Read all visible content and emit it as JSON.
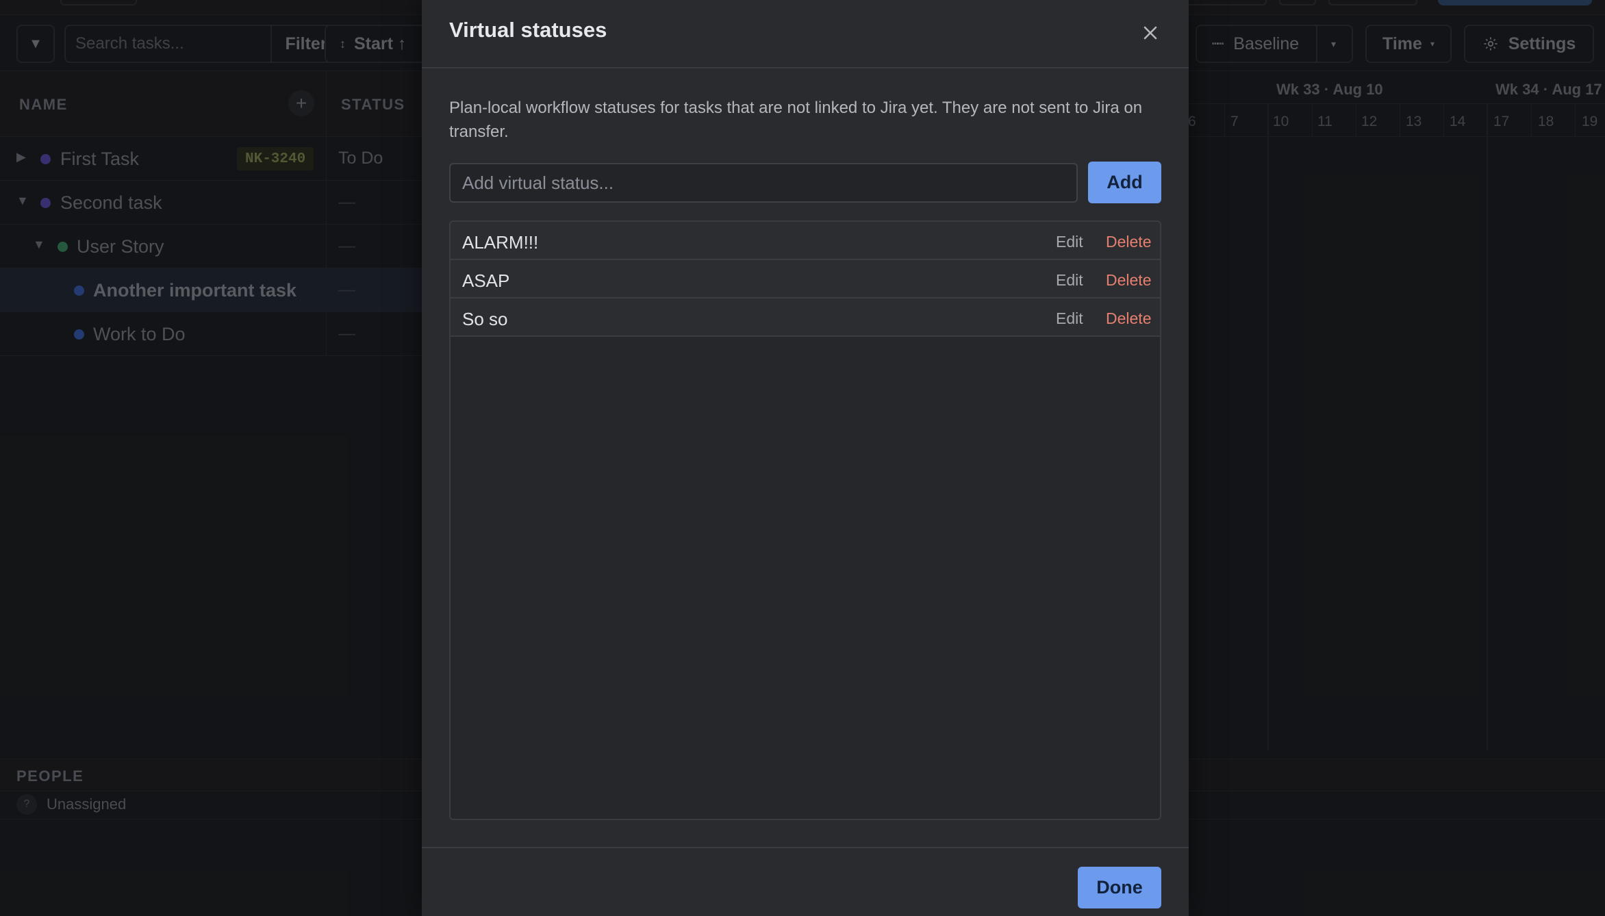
{
  "toolbar": {
    "search_placeholder": "Search tasks...",
    "filter_label": "Filter",
    "sort_label": "Start ↑",
    "baseline_label": "Baseline",
    "time_label": "Time",
    "settings_label": "Settings"
  },
  "grid": {
    "name_header": "NAME",
    "status_header": "STATUS",
    "rows": [
      {
        "name": "First Task",
        "key": "NK-3240",
        "status": "To Do",
        "dot_color": "#5b4fc4"
      },
      {
        "name": "Second task",
        "status": "—",
        "dot_color": "#5b4fc4"
      },
      {
        "name": "User Story",
        "status": "—",
        "dot_color": "#3f9a6a"
      },
      {
        "name": "Another important task",
        "status": "—",
        "dot_color": "#3a63c8"
      },
      {
        "name": "Work to Do",
        "status": "—",
        "dot_color": "#3a63c8"
      }
    ]
  },
  "timeline": {
    "weeks": [
      "Wk 33 · Aug 10",
      "Wk 34 · Aug 17"
    ],
    "days": [
      "6",
      "7",
      "10",
      "11",
      "12",
      "13",
      "14",
      "17",
      "18",
      "19"
    ]
  },
  "people": {
    "title": "PEOPLE",
    "unassigned": "Unassigned",
    "unassigned_icon": "?"
  },
  "modal": {
    "title": "Virtual statuses",
    "description": "Plan-local workflow statuses for tasks that are not linked to Jira yet. They are not sent to Jira on transfer.",
    "input_placeholder": "Add virtual status...",
    "add_label": "Add",
    "edit_label": "Edit",
    "delete_label": "Delete",
    "statuses": [
      "ALARM!!!",
      "ASAP",
      "So so"
    ],
    "done_label": "Done"
  },
  "colors": {
    "accent": "#6c9aec",
    "delete": "#e6806e",
    "jira_key_bg": "#2c311f"
  }
}
